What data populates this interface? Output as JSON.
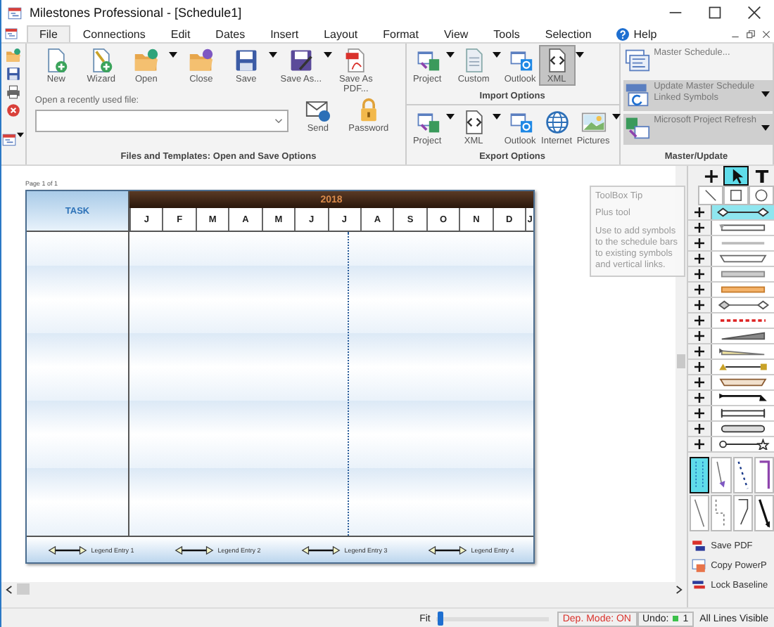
{
  "window": {
    "title": "Milestones Professional - [Schedule1]"
  },
  "menu": [
    {
      "label": "File",
      "kind": "tab",
      "selected": true
    },
    {
      "label": "Connections",
      "kind": "tab",
      "selected": false
    },
    {
      "label": "Edit",
      "kind": "tab",
      "selected": false
    },
    {
      "label": "Dates",
      "kind": "tab",
      "selected": false
    },
    {
      "label": "Insert",
      "kind": "tab",
      "selected": false
    },
    {
      "label": "Layout",
      "kind": "tab",
      "selected": false
    },
    {
      "label": "Format",
      "kind": "tab",
      "selected": false
    },
    {
      "label": "View",
      "kind": "tab",
      "selected": false
    },
    {
      "label": "Tools",
      "kind": "tab",
      "selected": false
    },
    {
      "label": "Selection",
      "kind": "tab",
      "selected": false
    },
    {
      "label": "Help",
      "kind": "help",
      "selected": false
    }
  ],
  "file_group": {
    "title": "Files and Templates: Open and Save Options",
    "buttons": [
      {
        "label": "New",
        "kind": "new",
        "dropdown": false
      },
      {
        "label": "Wizard",
        "kind": "wizard",
        "dropdown": false
      },
      {
        "label": "Open",
        "kind": "open",
        "dropdown": true
      },
      {
        "label": "Close",
        "kind": "close",
        "dropdown": false
      },
      {
        "label": "Save",
        "kind": "save",
        "dropdown": true
      },
      {
        "label": "Save As...",
        "kind": "saveas",
        "dropdown": true
      },
      {
        "label": "Save As PDF...",
        "kind": "pdf",
        "dropdown": false
      }
    ],
    "recent": {
      "label": "Open a recently used file:"
    },
    "extra_buttons": [
      {
        "label": "Send",
        "kind": "send"
      },
      {
        "label": "Password",
        "kind": "password"
      }
    ]
  },
  "import_group": {
    "title": "Import Options",
    "buttons": [
      {
        "label": "Project",
        "kind": "project",
        "dropdown": true,
        "selected": false
      },
      {
        "label": "Custom",
        "kind": "custom",
        "dropdown": true,
        "selected": false
      },
      {
        "label": "Outlook",
        "kind": "outlook",
        "dropdown": false,
        "selected": false
      },
      {
        "label": "XML",
        "kind": "xml",
        "dropdown": true,
        "selected": true
      }
    ]
  },
  "export_group": {
    "title": "Export Options",
    "buttons": [
      {
        "label": "Project",
        "kind": "project",
        "dropdown": true,
        "selected": false
      },
      {
        "label": "XML",
        "kind": "xml",
        "dropdown": true,
        "selected": false
      },
      {
        "label": "Outlook",
        "kind": "outlook",
        "dropdown": false,
        "selected": false
      },
      {
        "label": "Internet",
        "kind": "internet",
        "dropdown": false,
        "selected": false
      },
      {
        "label": "Pictures",
        "kind": "pictures",
        "dropdown": true,
        "selected": false
      }
    ]
  },
  "master_group": {
    "title": "Master/Update",
    "items": [
      {
        "label": "Master Schedule...",
        "kind": "master",
        "dropdown": false,
        "disabled": false
      },
      {
        "label": "Update Master Schedule Linked Symbols",
        "kind": "update",
        "dropdown": true,
        "disabled": true
      },
      {
        "label": "Microsoft Project Refresh",
        "kind": "refresh",
        "dropdown": true,
        "disabled": true
      }
    ]
  },
  "schedule": {
    "page_label": "Page 1 of 1",
    "task_header": "TASK",
    "year": "2018",
    "months": [
      "J",
      "F",
      "M",
      "A",
      "M",
      "J",
      "J",
      "A",
      "S",
      "O",
      "N",
      "D",
      "J"
    ],
    "legend": [
      "Legend Entry 1",
      "Legend Entry 2",
      "Legend Entry 3",
      "Legend Entry 4"
    ]
  },
  "tooltip": {
    "title": "ToolBox Tip",
    "lines": [
      "Plus tool",
      "Use to add symbols to the schedule bars to existing symbols and vertical links."
    ]
  },
  "toolbox": {
    "top_tools": [
      {
        "kind": "plus",
        "selected": false
      },
      {
        "kind": "pointer",
        "selected": true
      },
      {
        "kind": "text",
        "selected": false
      }
    ],
    "shape_tools": [
      {
        "kind": "line",
        "selected": false
      },
      {
        "kind": "rect",
        "selected": false
      },
      {
        "kind": "circle",
        "selected": false
      }
    ],
    "symbols": [
      {
        "selected": true
      },
      {
        "selected": false
      },
      {
        "selected": false
      },
      {
        "selected": false
      },
      {
        "selected": false
      },
      {
        "selected": false
      },
      {
        "selected": false
      },
      {
        "selected": false
      },
      {
        "selected": false
      },
      {
        "selected": false
      },
      {
        "selected": false
      },
      {
        "selected": false
      },
      {
        "selected": false
      },
      {
        "selected": false
      },
      {
        "selected": false
      },
      {
        "selected": false
      }
    ],
    "line_tools": [
      {
        "selected": true
      },
      {
        "selected": false
      },
      {
        "selected": false
      },
      {
        "selected": false
      },
      {
        "selected": false
      },
      {
        "selected": false
      },
      {
        "selected": false
      },
      {
        "selected": false
      }
    ],
    "actions": [
      {
        "label": "Save PDF",
        "kind": "savepdf"
      },
      {
        "label": "Copy PowerP",
        "kind": "ppt"
      },
      {
        "label": "Lock Baseline",
        "kind": "lock"
      }
    ]
  },
  "status": {
    "zoom": {
      "label": "Fit",
      "level": 0.02
    },
    "dep_mode": "Dep. Mode: ON",
    "undo": {
      "label": "Undo:",
      "count": "1"
    },
    "lines": "All Lines Visible"
  }
}
